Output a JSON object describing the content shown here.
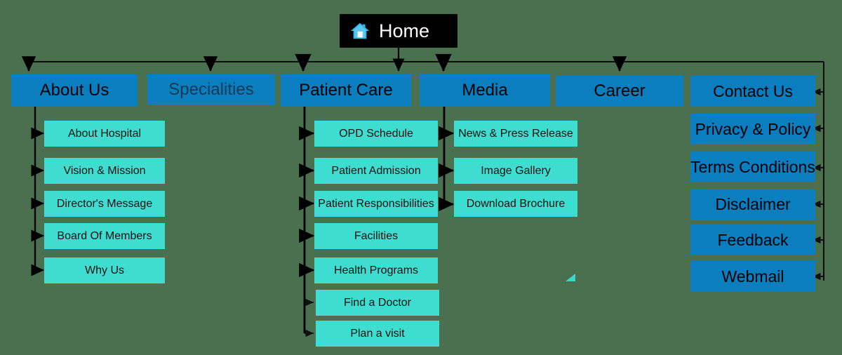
{
  "diagram": {
    "title": "Hospital Website Sitemap",
    "type": "sitemap-tree",
    "background_color": "#4a7050",
    "colors": {
      "root_fill": "#000000",
      "root_text": "#ffffff",
      "level1_fill": "#0b7ec0",
      "level2_fill": "#3fdcd0",
      "connector": "#000000",
      "home_icon": "#35b6e8"
    }
  },
  "root": {
    "label": "Home",
    "icon": "home-icon"
  },
  "level1": [
    {
      "id": "about-us",
      "label": "About Us"
    },
    {
      "id": "specialities",
      "label": "Specialities"
    },
    {
      "id": "patient-care",
      "label": "Patient Care"
    },
    {
      "id": "media",
      "label": "Media"
    },
    {
      "id": "career",
      "label": "Career"
    }
  ],
  "children": {
    "about_us": [
      {
        "label": "About Hospital"
      },
      {
        "label": "Vision & Mission"
      },
      {
        "label": "Director's Message"
      },
      {
        "label": "Board Of Members"
      },
      {
        "label": "Why Us"
      }
    ],
    "patient_care": [
      {
        "label": "OPD Schedule"
      },
      {
        "label": "Patient Admission"
      },
      {
        "label": "Patient Responsibilities"
      },
      {
        "label": "Facilities"
      },
      {
        "label": "Health Programs"
      },
      {
        "label": "Find a Doctor"
      },
      {
        "label": "Plan a visit"
      }
    ],
    "media": [
      {
        "label": "News & Press Release"
      },
      {
        "label": "Image Gallery"
      },
      {
        "label": "Download Brochure"
      }
    ]
  },
  "side_column": [
    {
      "id": "contact-us",
      "label": "Contact Us"
    },
    {
      "id": "privacy-policy",
      "label": "Privacy & Policy"
    },
    {
      "id": "terms-conditions",
      "label": "Terms Conditions"
    },
    {
      "id": "disclaimer",
      "label": "Disclaimer"
    },
    {
      "id": "feedback",
      "label": "Feedback"
    },
    {
      "id": "webmail",
      "label": "Webmail"
    }
  ]
}
